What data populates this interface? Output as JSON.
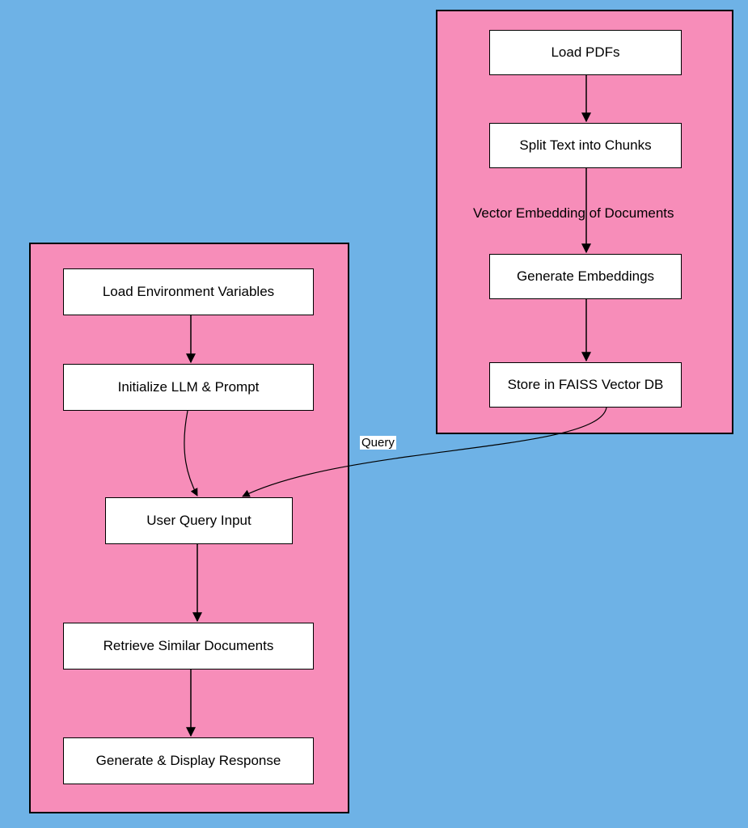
{
  "diagram": {
    "left_group": {
      "nodes": {
        "load_env": "Load Environment Variables",
        "init_llm": "Initialize LLM & Prompt",
        "user_query": "User Query Input",
        "retrieve": "Retrieve Similar Documents",
        "generate": "Generate & Display Response"
      }
    },
    "right_group": {
      "nodes": {
        "load_pdfs": "Load PDFs",
        "split_text": "Split Text into Chunks",
        "gen_embed": "Generate Embeddings",
        "store_faiss": "Store in FAISS Vector DB"
      },
      "section_label": "Vector Embedding of Documents"
    },
    "edge_labels": {
      "query": "Query"
    }
  }
}
